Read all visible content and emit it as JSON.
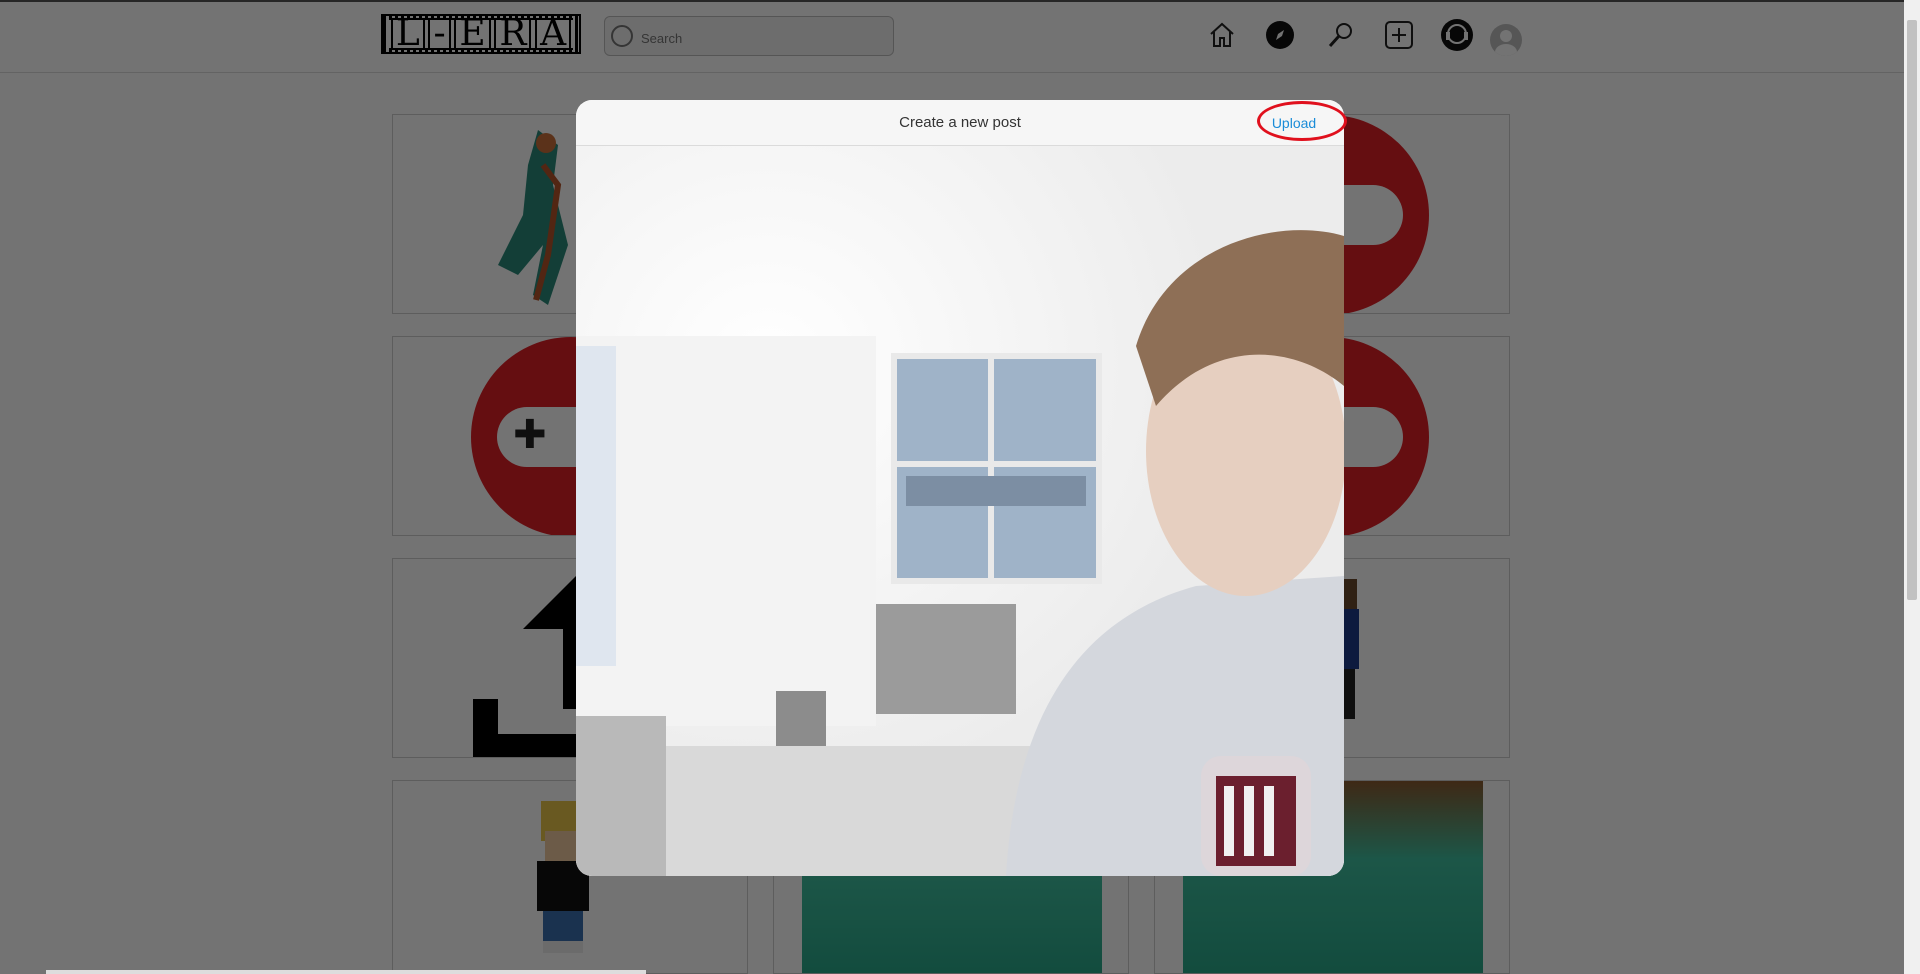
{
  "header": {
    "logo_text": "L-ERA",
    "search_placeholder": "Search"
  },
  "nav_icons": [
    "home-icon",
    "explore-icon",
    "search-icon",
    "add-post-icon",
    "messages-icon",
    "profile-avatar-icon"
  ],
  "modal": {
    "title": "Create a new post",
    "upload_label": "Upload",
    "highlight_color": "#e0101d",
    "link_color": "#1a8cd8"
  },
  "colors": {
    "controller_red": "#e01f26",
    "overlay": "rgba(0,0,0,0.55)"
  }
}
